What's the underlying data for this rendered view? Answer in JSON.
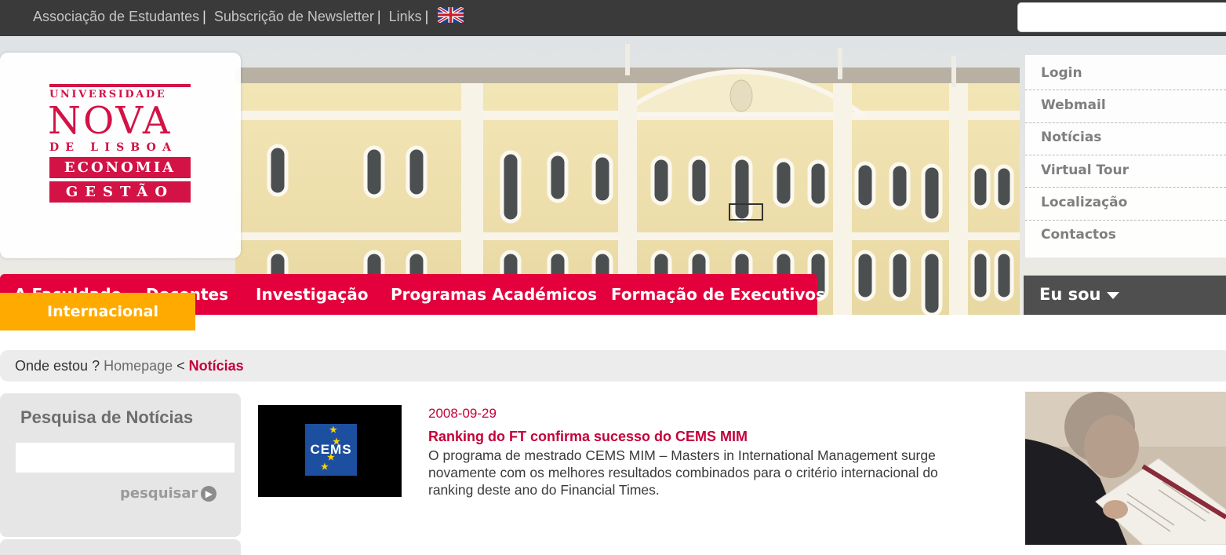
{
  "topbar": {
    "links": [
      "Associação de Estudantes",
      "Subscrição de Newsletter",
      "Links"
    ],
    "separator": "|",
    "language_icon": "uk-flag-icon"
  },
  "logo": {
    "line1": "UNIVERSIDADE",
    "line2": "NOVA",
    "line3": "DE LISBOA",
    "line4": "ECONOMIA",
    "line5": "GESTÃO",
    "color": "#d31246"
  },
  "quick_menu": [
    "Login",
    "Webmail",
    "Notícias",
    "Virtual Tour",
    "Localização",
    "Contactos"
  ],
  "eu_sou": "Eu sou",
  "main_nav": [
    "A Faculdade",
    "Docentes",
    "Investigação",
    "Programas Académicos",
    "Formação de Executivos"
  ],
  "orange_tab": "Internacional",
  "breadcrumb": {
    "prefix": "Onde estou ? ",
    "home": "Homepage",
    "sep": " < ",
    "current": "Notícias"
  },
  "news_search": {
    "title": "Pesquisa de Notícias",
    "input_value": "",
    "button": "pesquisar"
  },
  "news": [
    {
      "date": "2008-09-29",
      "title": "Ranking do FT confirma sucesso do CEMS MIM",
      "body": "O programa de mestrado CEMS MIM – Masters in International Management surge novamente com os melhores resultados combinados para o critério internacional do ranking deste ano do Financial Times.",
      "thumb_text": "CEMS"
    }
  ],
  "colors": {
    "accent_red": "#e4003d",
    "accent_orange": "#ffaa00",
    "dark_bar": "#3a3a3a"
  }
}
